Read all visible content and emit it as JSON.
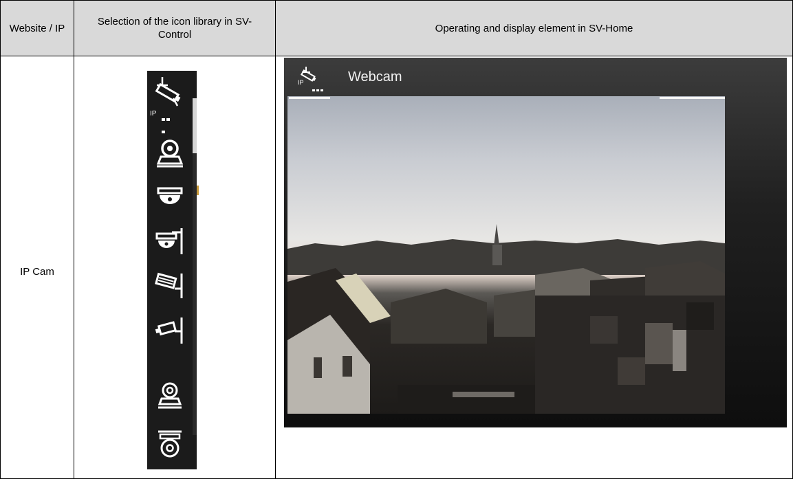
{
  "table": {
    "headers": [
      "Website / IP",
      "Selection of the icon library in SV-Control",
      "Operating and display element in SV-Home"
    ],
    "row_label": "IP Cam"
  },
  "icon_library": {
    "ip_label": "IP",
    "icons": [
      "ip-camera-icon",
      "ptz-camera-icon",
      "dome-camera-icon",
      "wall-dome-camera-icon",
      "wall-bullet-camera-icon",
      "wall-box-camera-icon",
      "ptz-small-camera-icon",
      "ptz-ceiling-camera-icon"
    ]
  },
  "svhome": {
    "title": "Webcam",
    "ip_label": "IP",
    "icon": "ip-camera-icon"
  },
  "colors": {
    "header_bg": "#d9d9d9",
    "panel_bg": "#1b1b1b"
  }
}
